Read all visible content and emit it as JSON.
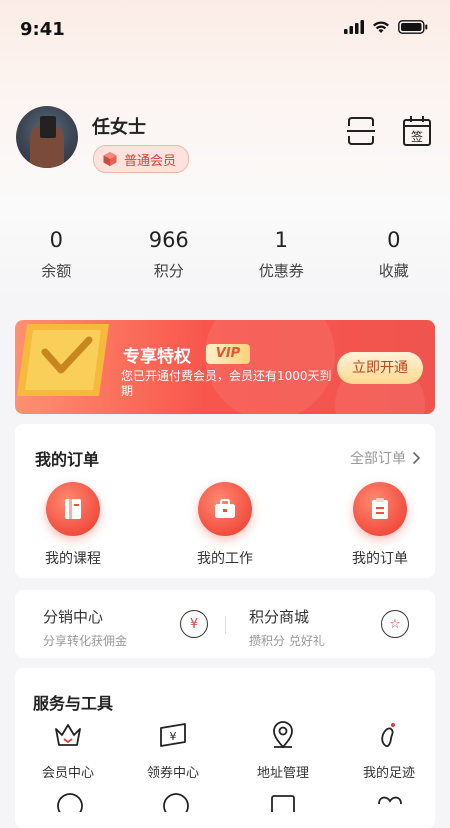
{
  "status_bar": {
    "time": "9:41"
  },
  "profile": {
    "username": "任女士",
    "member_level": "普通会员"
  },
  "stats": [
    {
      "value": "0",
      "label": "余额"
    },
    {
      "value": "966",
      "label": "积分"
    },
    {
      "value": "1",
      "label": "优惠券"
    },
    {
      "value": "0",
      "label": "收藏"
    }
  ],
  "vip": {
    "title": "专享特权",
    "tag": "VIP",
    "description": "您已开通付费会员，会员还有1000天到期",
    "button": "立即开通"
  },
  "orders": {
    "title": "我的订单",
    "all_link": "全部订单",
    "items": [
      {
        "label": "我的课程",
        "icon": "book-icon"
      },
      {
        "label": "我的工作",
        "icon": "briefcase-icon"
      },
      {
        "label": "我的订单",
        "icon": "clipboard-icon"
      }
    ]
  },
  "distribution": {
    "left_title": "分销中心",
    "left_sub": "分享转化获佣金",
    "left_icon_char": "¥",
    "right_title": "积分商城",
    "right_sub": "攒积分 兑好礼",
    "right_icon_char": "☆"
  },
  "services": {
    "title": "服务与工具",
    "items": [
      {
        "label": "会员中心",
        "icon": "crown-icon"
      },
      {
        "label": "领券中心",
        "icon": "coupon-icon"
      },
      {
        "label": "地址管理",
        "icon": "location-icon"
      },
      {
        "label": "我的足迹",
        "icon": "footprint-icon"
      }
    ]
  },
  "colors": {
    "accent": "#f24e3f",
    "vip_banner": "#f8564c",
    "button_gold": "#ffd890"
  }
}
